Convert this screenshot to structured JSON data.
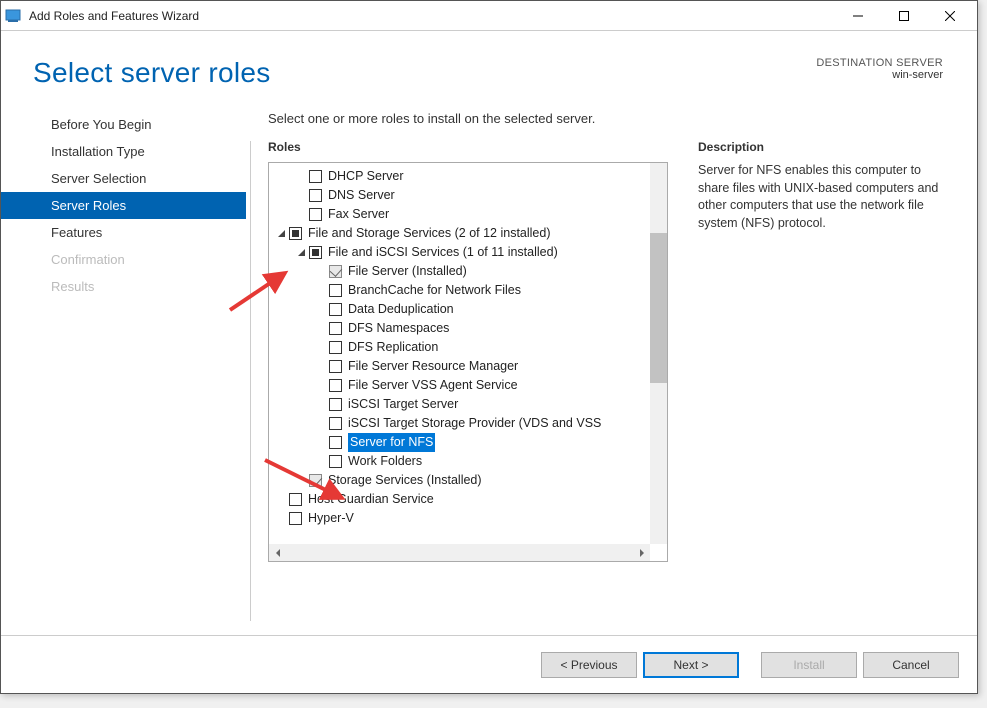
{
  "window": {
    "title": "Add Roles and Features Wizard"
  },
  "header": {
    "page_title": "Select server roles",
    "destination_label": "DESTINATION SERVER",
    "destination_name": "win-server"
  },
  "nav": {
    "items": [
      {
        "label": "Before You Begin",
        "state": "normal"
      },
      {
        "label": "Installation Type",
        "state": "normal"
      },
      {
        "label": "Server Selection",
        "state": "normal"
      },
      {
        "label": "Server Roles",
        "state": "active"
      },
      {
        "label": "Features",
        "state": "normal"
      },
      {
        "label": "Confirmation",
        "state": "disabled"
      },
      {
        "label": "Results",
        "state": "disabled"
      }
    ]
  },
  "main": {
    "instruction": "Select one or more roles to install on the selected server.",
    "roles_label": "Roles",
    "description_label": "Description",
    "description_text": "Server for NFS enables this computer to share files with UNIX-based computers and other computers that use the network file system (NFS) protocol."
  },
  "tree": [
    {
      "indent": 2,
      "check": "none",
      "label": "DHCP Server"
    },
    {
      "indent": 2,
      "check": "none",
      "label": "DNS Server"
    },
    {
      "indent": 2,
      "check": "none",
      "label": "Fax Server"
    },
    {
      "indent": 1,
      "expander": "open",
      "check": "tri",
      "label": "File and Storage Services (2 of 12 installed)"
    },
    {
      "indent": 2,
      "expander": "open",
      "check": "tri",
      "label": "File and iSCSI Services (1 of 11 installed)"
    },
    {
      "indent": 3,
      "check": "checked",
      "label": "File Server (Installed)"
    },
    {
      "indent": 3,
      "check": "none",
      "label": "BranchCache for Network Files"
    },
    {
      "indent": 3,
      "check": "none",
      "label": "Data Deduplication"
    },
    {
      "indent": 3,
      "check": "none",
      "label": "DFS Namespaces"
    },
    {
      "indent": 3,
      "check": "none",
      "label": "DFS Replication"
    },
    {
      "indent": 3,
      "check": "none",
      "label": "File Server Resource Manager"
    },
    {
      "indent": 3,
      "check": "none",
      "label": "File Server VSS Agent Service"
    },
    {
      "indent": 3,
      "check": "none",
      "label": "iSCSI Target Server"
    },
    {
      "indent": 3,
      "check": "none",
      "label": "iSCSI Target Storage Provider (VDS and VSS"
    },
    {
      "indent": 3,
      "check": "none",
      "label": "Server for NFS",
      "selected": true
    },
    {
      "indent": 3,
      "check": "none",
      "label": "Work Folders"
    },
    {
      "indent": 2,
      "check": "checked",
      "label": "Storage Services (Installed)"
    },
    {
      "indent": 1,
      "check": "none",
      "label": "Host Guardian Service"
    },
    {
      "indent": 1,
      "check": "none",
      "label": "Hyper-V"
    }
  ],
  "footer": {
    "previous": "< Previous",
    "next": "Next >",
    "install": "Install",
    "cancel": "Cancel"
  }
}
